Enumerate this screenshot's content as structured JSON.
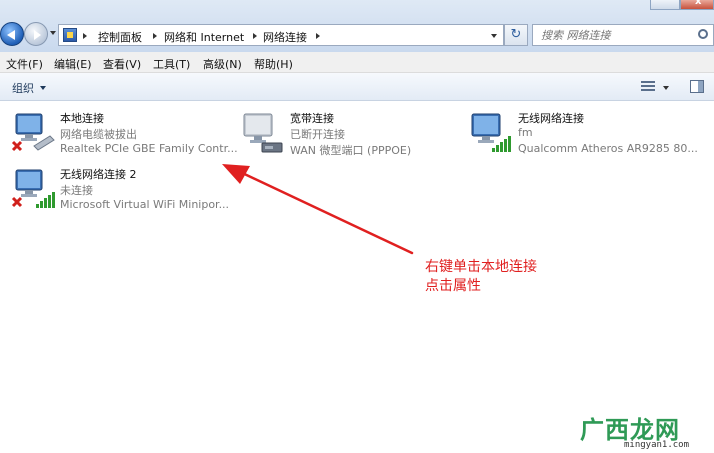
{
  "address_bar": {
    "crumbs": [
      "控制面板",
      "网络和 Internet",
      "网络连接"
    ],
    "search_placeholder": "搜索 网络连接"
  },
  "menu": [
    "文件(F)",
    "编辑(E)",
    "查看(V)",
    "工具(T)",
    "高级(N)",
    "帮助(H)"
  ],
  "toolbar": {
    "organize_label": "组织"
  },
  "connections": [
    {
      "name": "本地连接",
      "status": "网络电缆被拔出",
      "device": "Realtek PCIe GBE Family Contr...",
      "type": "ethernet",
      "disconnected": true
    },
    {
      "name": "宽带连接",
      "status": "已断开连接",
      "device": "WAN 微型端口 (PPPOE)",
      "type": "broadband",
      "disconnected": false
    },
    {
      "name": "无线网络连接",
      "status": "fm",
      "device": "Qualcomm Atheros AR9285 80...",
      "type": "wireless",
      "disconnected": false
    },
    {
      "name": "无线网络连接 2",
      "status": "未连接",
      "device": "Microsoft Virtual WiFi Minipor...",
      "type": "wireless",
      "disconnected": true
    }
  ],
  "annotation": {
    "line1": "右键单击本地连接",
    "line2": "点击属性",
    "color": "#e02020"
  },
  "watermark": {
    "text": "广西龙网",
    "url": "mingyan1.com"
  }
}
